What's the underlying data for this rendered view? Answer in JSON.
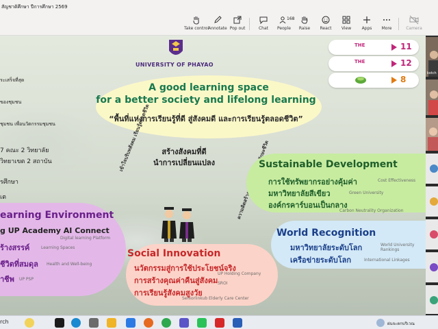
{
  "window": {
    "title": "สัญชาติศึกษา ปีการศึกษา 2569"
  },
  "toolbar": {
    "take_control": "Take control",
    "annotate": "Annotate",
    "pop_out": "Pop out",
    "chat": "Chat",
    "people": "People",
    "people_count": "168",
    "raise": "Raise",
    "react": "React",
    "view": "View",
    "apps": "Apps",
    "more": "More",
    "camera": "Camera"
  },
  "slide": {
    "university": "UNIVERSITY OF PHAYAO",
    "headline_1": "A good learning space",
    "headline_2": "for a better society and lifelong learning",
    "headline_th": "“พื้นที่แห่งการเรียนรู้ที่ดี สู่สังคมดี และการเรียนรู้ตลอดชีวิต”",
    "rankings": [
      {
        "logo": "THE",
        "value": "11",
        "color": "#c0267a"
      },
      {
        "logo": "THE",
        "value": "12",
        "color": "#c0267a"
      },
      {
        "logo": "green",
        "value": "8",
        "color": "#e07a12"
      }
    ],
    "left_list": [
      "ระเสร็จที่สุด",
      "ของชุมชน",
      "ชุมชน เพื่อนวัตกรรมชุมชน",
      "7 คณะ 2 วิทยาลัย",
      "วิทยาเขต 2 สถาบัน",
      "รศึกษา",
      "เต"
    ],
    "center_1": "สร้างสังคมที่ดี",
    "center_2": "นำการเปลี่ยนแปลง",
    "arc_left": "เข้าใจบริบทสังคม  เรียนรู้ตลอดชีวิต",
    "arc_right": "ความคิดสร้างสรรค์  ดิจิทัล AI ทักษะชีวิต",
    "arc_bottom": "ความคิดสร้างสรรค์",
    "sustainable": {
      "title": "Sustainable Development",
      "items": [
        {
          "th": "การใช้ทรัพยากรอย่างคุ้มค่า",
          "en": "Cost Effectiveness"
        },
        {
          "th": "มหาวิทยาลัยสีเขียว",
          "en": "Green University"
        },
        {
          "th": "องค์กรคาร์บอนเป็นกลาง",
          "en": "Carbon Neutrality Organization"
        }
      ]
    },
    "world": {
      "title": "World Recognition",
      "items": [
        {
          "th": "มหาวิทยาลัยระดับโลก",
          "en": "World University Rankings"
        },
        {
          "th": "เครือข่ายระดับโลก",
          "en": "International Linkages"
        }
      ]
    },
    "learning": {
      "title": "earning Environment",
      "line1": "g UP Academy AI Connect",
      "items": [
        {
          "th": "ร้างสรรค์",
          "en": "Learning Spaces"
        },
        {
          "th": "ชีวิตที่สมดุล",
          "en": "Health and Well-being"
        },
        {
          "th": "าชีพ",
          "en": "UP PSP"
        }
      ],
      "line1_sub": "Digital learning Platform"
    },
    "social": {
      "title": "Social Innovation",
      "items": [
        {
          "th": "นวัตกรรมสู่การใช้ประโยชน์จริง",
          "en": "UP Holding Company"
        },
        {
          "th": "การสร้างคุณค่าคืนสู่สังคม",
          "en": "SROI"
        },
        {
          "th": "การเรียนรู้สังคมสูงวัย",
          "en": "Seniorlinkub Elderly Care Center"
        }
      ]
    }
  },
  "participants": [
    {
      "name": "kotch"
    }
  ],
  "taskbar": {
    "search": "rch",
    "weather": "ฝนจะตกบริเวณ"
  }
}
